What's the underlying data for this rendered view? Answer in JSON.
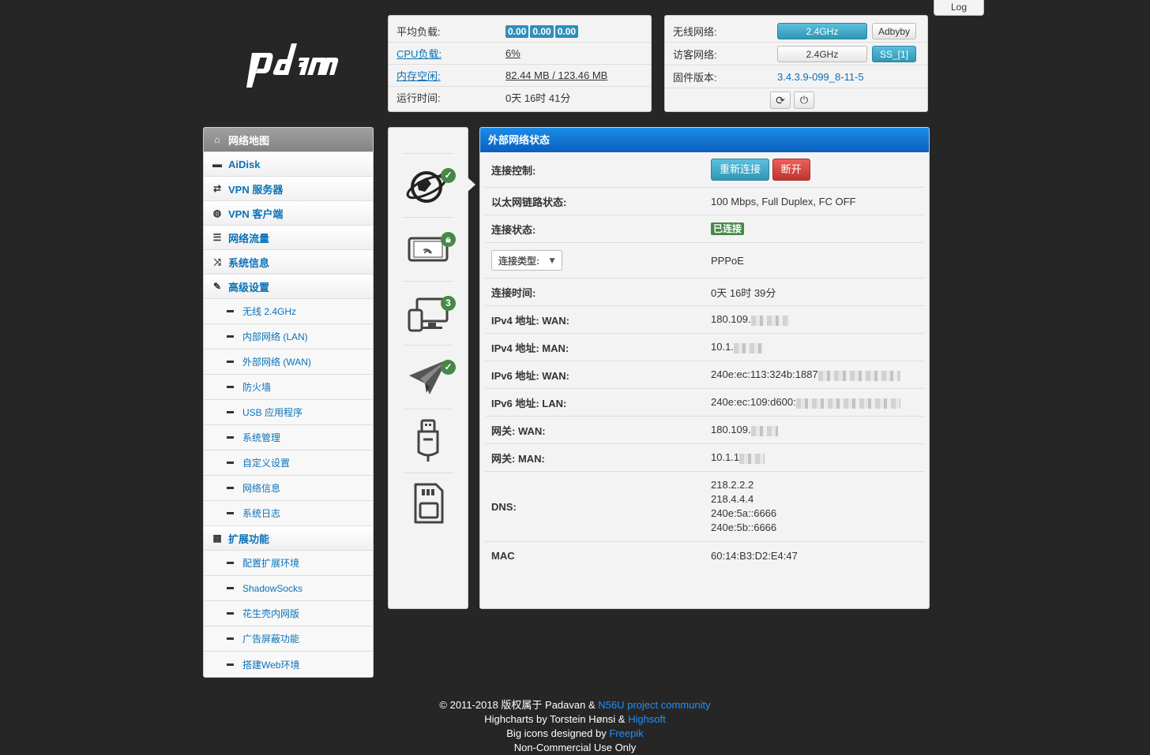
{
  "log_button": "Log",
  "logo_text": "padavan",
  "stats": {
    "load_label": "平均负载:",
    "load_values": [
      "0.00",
      "0.00",
      "0.00"
    ],
    "cpu_label": "CPU负载:",
    "cpu_value": "6%",
    "mem_label": "内存空闲:",
    "mem_value": "82.44 MB / 123.46 MB",
    "uptime_label": "运行时间:",
    "uptime_value": "0天 16时 41分"
  },
  "wireless": {
    "wifi_label": "无线网络:",
    "wifi_btn": "2.4GHz",
    "adbyby_btn": "Adbyby",
    "guest_label": "访客网络:",
    "guest_btn": "2.4GHz",
    "ss_btn": "SS_[1]",
    "fw_label": "固件版本:",
    "fw_value": "3.4.3.9-099_8-11-5"
  },
  "sidebar": {
    "items": [
      {
        "label": "网络地图",
        "icon": "home-icon",
        "glyph": "⌂"
      },
      {
        "label": "AiDisk",
        "icon": "hdd-icon",
        "glyph": "▬"
      },
      {
        "label": "VPN 服务器",
        "icon": "retweet-icon",
        "glyph": "⇄"
      },
      {
        "label": "VPN 客户端",
        "icon": "globe-icon",
        "glyph": "◍"
      },
      {
        "label": "网络流量",
        "icon": "list-icon",
        "glyph": "☰"
      },
      {
        "label": "系统信息",
        "icon": "random-icon",
        "glyph": "⤨"
      },
      {
        "label": "高级设置",
        "icon": "wrench-icon",
        "glyph": "✎"
      }
    ],
    "advanced": [
      "无线 2.4GHz",
      "内部网络 (LAN)",
      "外部网络 (WAN)",
      "防火墙",
      "USB 应用程序",
      "系统管理",
      "自定义设置",
      "网络信息",
      "系统日志"
    ],
    "ext_label": "扩展功能",
    "ext": [
      "配置扩展环境",
      "ShadowSocks",
      "花生壳内网版",
      "广告屏蔽功能",
      "搭建Web环境"
    ]
  },
  "icons": {
    "clients_count": "3"
  },
  "wan": {
    "title": "外部网络状态",
    "control_label": "连接控制:",
    "reconnect_btn": "重新连接",
    "disconnect_btn": "断开",
    "link_label": "以太网链路状态:",
    "link_value": "100 Mbps, Full Duplex, FC OFF",
    "status_label": "连接状态:",
    "status_value": "已连接",
    "type_select": "连接类型:",
    "type_value": "PPPoE",
    "time_label": "连接时间:",
    "time_value": "0天 16时 39分",
    "ipv4_wan_label": "IPv4 地址: WAN:",
    "ipv4_wan_value": "180.109.",
    "ipv4_man_label": "IPv4 地址: MAN:",
    "ipv4_man_value": "10.1.",
    "ipv6_wan_label": "IPv6 地址: WAN:",
    "ipv6_wan_value": "240e:ec:113:324b:1887",
    "ipv6_lan_label": "IPv6 地址: LAN:",
    "ipv6_lan_value": "240e:ec:109:d600:",
    "gw_wan_label": "网关: WAN:",
    "gw_wan_value": "180.109.",
    "gw_man_label": "网关: MAN:",
    "gw_man_value": "10.1.1",
    "dns_label": "DNS:",
    "dns_values": [
      "218.2.2.2",
      "218.4.4.4",
      "240e:5a::6666",
      "240e:5b::6666"
    ],
    "mac_label": "MAC",
    "mac_value": "60:14:B3:D2:E4:47"
  },
  "footer": {
    "line1_prefix": "© 2011-2018 版权属于 Padavan &",
    "line1_link": "N56U project community",
    "line2_prefix": "Highcharts by Torstein Hønsi &",
    "line2_link": "Highsoft",
    "line3_prefix": "Big icons designed by",
    "line3_link": "Freepik",
    "line4": "Non-Commercial Use Only"
  }
}
